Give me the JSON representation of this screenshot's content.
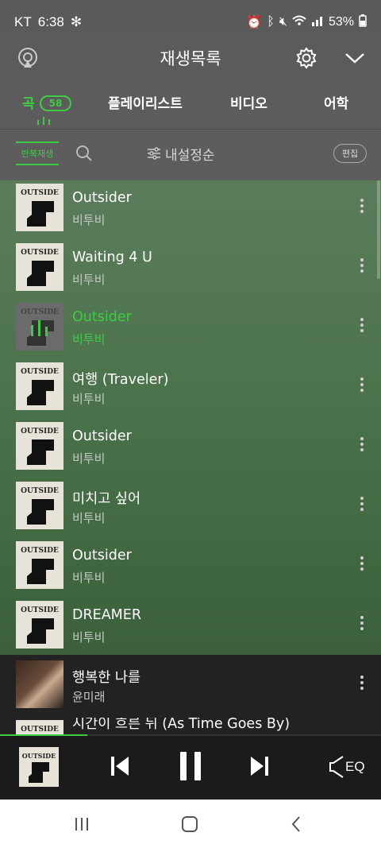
{
  "status": {
    "carrier": "KT",
    "time": "6:38",
    "battery": "53%"
  },
  "header": {
    "title": "재생목록"
  },
  "tabs": [
    {
      "label": "곡",
      "count": "58",
      "active": true
    },
    {
      "label": "플레이리스트"
    },
    {
      "label": "비디오"
    },
    {
      "label": "어학"
    }
  ],
  "toolbar": {
    "repeat_label": "반복재생",
    "sort_label": "내설정순",
    "edit_label": "편집"
  },
  "album_art_text": "OUTSIDE",
  "songs": [
    {
      "title": "Outsider",
      "artist": "비투비"
    },
    {
      "title": "Waiting 4 U",
      "artist": "비투비"
    },
    {
      "title": "Outsider",
      "artist": "비투비",
      "current": true
    },
    {
      "title": "여행 (Traveler)",
      "artist": "비투비"
    },
    {
      "title": "Outsider",
      "artist": "비투비"
    },
    {
      "title": "미치고 싶어",
      "artist": "비투비"
    },
    {
      "title": "Outsider",
      "artist": "비투비"
    },
    {
      "title": "DREAMER",
      "artist": "비투비"
    },
    {
      "title": "행복한 나를",
      "artist": "윤미래"
    },
    {
      "title": "시간이 흐른 뒤 (As Time Goes By)",
      "artist": ""
    }
  ],
  "player": {
    "progress": 0.23,
    "eq_label": "EQ"
  },
  "colors": {
    "accent": "#3ccd44"
  },
  "icons": [
    "cast-icon",
    "gear-icon",
    "chevron-down-icon",
    "search-icon",
    "sort-icon",
    "more-icon",
    "prev-icon",
    "pause-icon",
    "next-icon",
    "eq-icon",
    "recent-apps-icon",
    "home-icon",
    "back-icon"
  ]
}
